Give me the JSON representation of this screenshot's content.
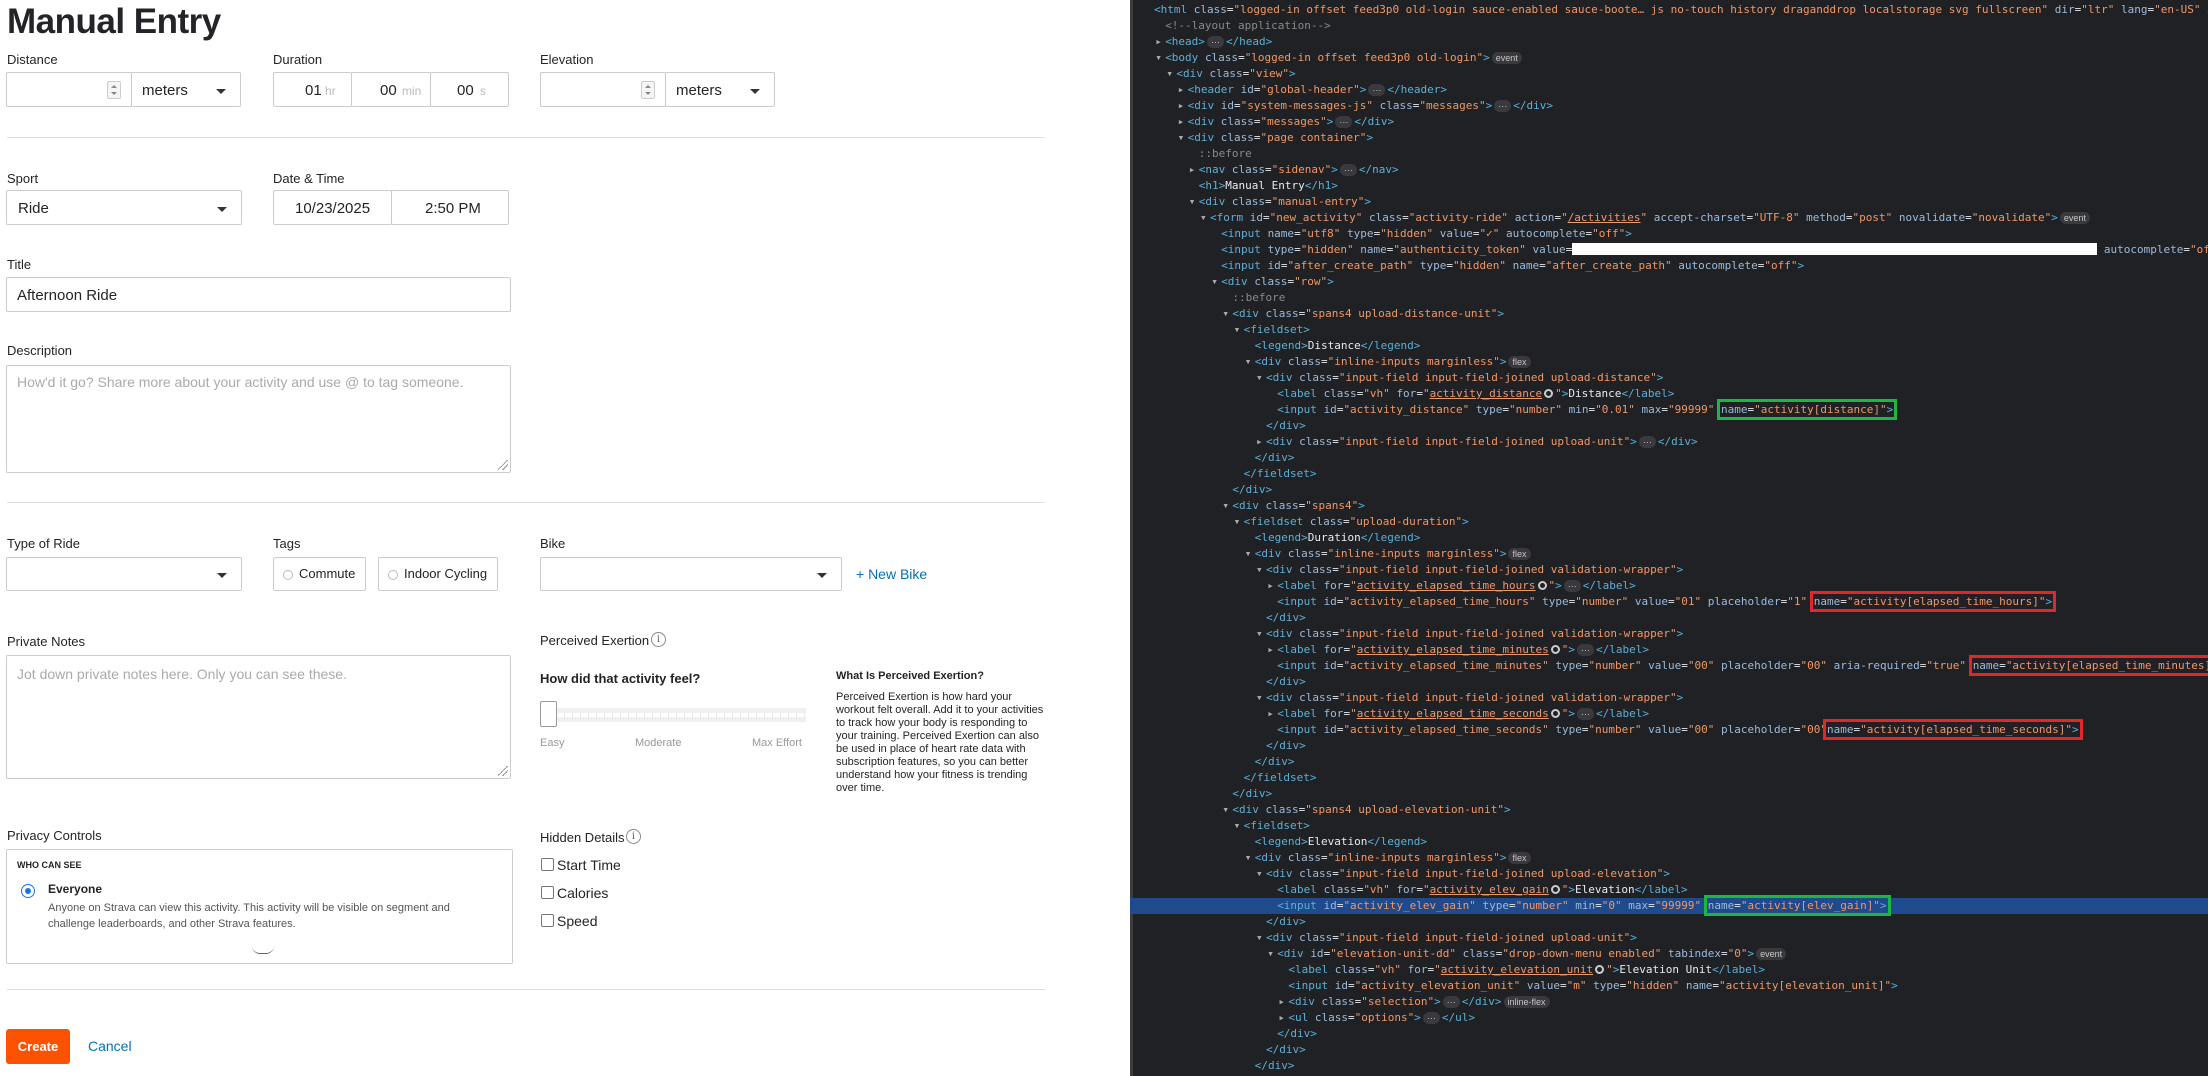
{
  "form": {
    "page_title": "Manual Entry",
    "distance": {
      "label": "Distance",
      "value": "",
      "unit": "meters"
    },
    "duration": {
      "label": "Duration",
      "hours": "01",
      "hours_unit": "hr",
      "minutes": "00",
      "minutes_unit": "min",
      "seconds": "00",
      "seconds_unit": "s"
    },
    "elevation": {
      "label": "Elevation",
      "value": "",
      "unit": "meters"
    },
    "sport": {
      "label": "Sport",
      "value": "Ride"
    },
    "datetime": {
      "label": "Date & Time",
      "date": "10/23/2025",
      "time": "2:50 PM"
    },
    "title": {
      "label": "Title",
      "value": "Afternoon Ride"
    },
    "description": {
      "label": "Description",
      "placeholder": "How'd it go? Share more about your activity and use @ to tag someone."
    },
    "type_of_ride": {
      "label": "Type of Ride",
      "value": ""
    },
    "tags": {
      "label": "Tags",
      "items": [
        "Commute",
        "Indoor Cycling"
      ]
    },
    "bike": {
      "label": "Bike",
      "value": "",
      "new_bike": "+ New Bike"
    },
    "private_notes": {
      "label": "Private Notes",
      "placeholder": "Jot down private notes here. Only you can see these."
    },
    "perceived_exertion": {
      "label": "Perceived Exertion",
      "question": "How did that activity feel?",
      "scale": [
        "Easy",
        "Moderate",
        "Max Effort"
      ],
      "level": 0,
      "help_title": "What Is Perceived Exertion?",
      "help_text": "Perceived Exertion is how hard your workout felt overall. Add it to your activities to track how your body is responding to your training. Perceived Exertion can also be used in place of heart rate data with subscription features, so you can better understand how your fitness is trending over time."
    },
    "privacy": {
      "label": "Privacy Controls",
      "who_can_see": "WHO CAN SEE",
      "option_title": "Everyone",
      "option_desc": "Anyone on Strava can view this activity. This activity will be visible on segment and challenge leaderboards, and other Strava features."
    },
    "hidden_details": {
      "label": "Hidden Details",
      "items": [
        "Start Time",
        "Calories",
        "Speed"
      ]
    },
    "create_button": "Create",
    "cancel_link": "Cancel"
  },
  "devtools": {
    "colors": {
      "tag": "#5db0d7",
      "attr_name": "#9bbbdc",
      "attr_value": "#f29766",
      "highlight_green": "#1db543",
      "highlight_red": "#e2262c"
    },
    "lines": [
      {
        "i": 0,
        "t": "",
        "h": "<span class=\"tg\">&lt;html</span> <span class=\"an\">class</span>=<span class=\"av\">\"logged-in offset feed3p0 old-login sauce-enabled sauce-boote… js no-touch history draganddrop localstorage svg fullscreen\"</span> <span class=\"an\">dir</span>=<span class=\"av\">\"ltr\"</span> <span class=\"an\">lang</span>=<span class=\"av\">\"en-US\"</span> <span class=\"an\">xmlns</span>=<span class=\"av\">\"<span class=\"lk\">http://www</span></span>"
      },
      {
        "i": 1,
        "t": "",
        "h": "<span class=\"cm\">&lt;!--layout application--&gt;</span>"
      },
      {
        "i": 1,
        "t": "▸",
        "h": "<span class=\"tg\">&lt;head&gt;</span><span class=\"pill\">···</span><span class=\"tg\">&lt;/head&gt;</span>"
      },
      {
        "i": 1,
        "t": "▾",
        "h": "<span class=\"tg\">&lt;body</span> <span class=\"an\">class</span>=<span class=\"av\">\"logged-in offset feed3p0 old-login\"</span><span class=\"tg\">&gt;</span><span class=\"pill\">event</span>"
      },
      {
        "i": 2,
        "t": "▾",
        "h": "<span class=\"tg\">&lt;div</span> <span class=\"an\">class</span>=<span class=\"av\">\"view\"</span><span class=\"tg\">&gt;</span>"
      },
      {
        "i": 3,
        "t": "▸",
        "h": "<span class=\"tg\">&lt;header</span> <span class=\"an\">id</span>=<span class=\"av\">\"global-header\"</span><span class=\"tg\">&gt;</span><span class=\"pill\">···</span><span class=\"tg\">&lt;/header&gt;</span>"
      },
      {
        "i": 3,
        "t": "▸",
        "h": "<span class=\"tg\">&lt;div</span> <span class=\"an\">id</span>=<span class=\"av\">\"system-messages-js\"</span> <span class=\"an\">class</span>=<span class=\"av\">\"messages\"</span><span class=\"tg\">&gt;</span><span class=\"pill\">···</span><span class=\"tg\">&lt;/div&gt;</span>"
      },
      {
        "i": 3,
        "t": "▸",
        "h": "<span class=\"tg\">&lt;div</span> <span class=\"an\">class</span>=<span class=\"av\">\"messages\"</span><span class=\"tg\">&gt;</span><span class=\"pill\">···</span><span class=\"tg\">&lt;/div&gt;</span>"
      },
      {
        "i": 3,
        "t": "▾",
        "h": "<span class=\"tg\">&lt;div</span> <span class=\"an\">class</span>=<span class=\"av\">\"page container\"</span><span class=\"tg\">&gt;</span>"
      },
      {
        "i": 4,
        "t": "",
        "h": "<span class=\"cm\">::before</span>"
      },
      {
        "i": 4,
        "t": "▸",
        "h": "<span class=\"tg\">&lt;nav</span> <span class=\"an\">class</span>=<span class=\"av\">\"sidenav\"</span><span class=\"tg\">&gt;</span><span class=\"pill\">···</span><span class=\"tg\">&lt;/nav&gt;</span>"
      },
      {
        "i": 4,
        "t": "",
        "h": "<span class=\"tg\">&lt;h1&gt;</span>Manual Entry<span class=\"tg\">&lt;/h1&gt;</span>"
      },
      {
        "i": 4,
        "t": "▾",
        "h": "<span class=\"tg\">&lt;div</span> <span class=\"an\">class</span>=<span class=\"av\">\"manual-entry\"</span><span class=\"tg\">&gt;</span>"
      },
      {
        "i": 5,
        "t": "▾",
        "h": "<span class=\"tg\">&lt;form</span> <span class=\"an\">id</span>=<span class=\"av\">\"new_activity\"</span> <span class=\"an\">class</span>=<span class=\"av\">\"activity-ride\"</span> <span class=\"an\">action</span>=<span class=\"av\">\"<span class=\"lk\">/activities</span>\"</span> <span class=\"an\">accept-charset</span>=<span class=\"av\">\"UTF-8\"</span> <span class=\"an\">method</span>=<span class=\"av\">\"post\"</span> <span class=\"an\">novalidate</span>=<span class=\"av\">\"novalidate\"</span><span class=\"tg\">&gt;</span><span class=\"pill\">event</span>"
      },
      {
        "i": 6,
        "t": "",
        "h": "<span class=\"tg\">&lt;input</span> <span class=\"an\">name</span>=<span class=\"av\">\"utf8\"</span> <span class=\"an\">type</span>=<span class=\"av\">\"hidden\"</span> <span class=\"an\">value</span>=<span class=\"av\">\"✓\"</span> <span class=\"an\">autocomplete</span>=<span class=\"av\">\"off\"</span><span class=\"tg\">&gt;</span>"
      },
      {
        "i": 6,
        "t": "",
        "h": "<span class=\"tg\">&lt;input</span> <span class=\"an\">type</span>=<span class=\"av\">\"hidden\"</span> <span class=\"an\">name</span>=<span class=\"av\">\"authenticity_token\"</span> <span class=\"an\">value</span>=<span class=\"redact\"></span> <span class=\"an\">autocomplete</span>=<span class=\"av\">\"off\"</span><span class=\"tg\">&gt;</span>"
      },
      {
        "i": 6,
        "t": "",
        "h": "<span class=\"tg\">&lt;input</span> <span class=\"an\">id</span>=<span class=\"av\">\"after_create_path\"</span> <span class=\"an\">type</span>=<span class=\"av\">\"hidden\"</span> <span class=\"an\">name</span>=<span class=\"av\">\"after_create_path\"</span> <span class=\"an\">autocomplete</span>=<span class=\"av\">\"off\"</span><span class=\"tg\">&gt;</span>"
      },
      {
        "i": 6,
        "t": "▾",
        "h": "<span class=\"tg\">&lt;div</span> <span class=\"an\">class</span>=<span class=\"av\">\"row\"</span><span class=\"tg\">&gt;</span>"
      },
      {
        "i": 7,
        "t": "",
        "h": "<span class=\"cm\">::before</span>"
      },
      {
        "i": 7,
        "t": "▾",
        "h": "<span class=\"tg\">&lt;div</span> <span class=\"an\">class</span>=<span class=\"av\">\"spans4 upload-distance-unit\"</span><span class=\"tg\">&gt;</span>"
      },
      {
        "i": 8,
        "t": "▾",
        "h": "<span class=\"tg\">&lt;fieldset&gt;</span>"
      },
      {
        "i": 9,
        "t": "",
        "h": "<span class=\"tg\">&lt;legend&gt;</span>Distance<span class=\"tg\">&lt;/legend&gt;</span>"
      },
      {
        "i": 9,
        "t": "▾",
        "h": "<span class=\"tg\">&lt;div</span> <span class=\"an\">class</span>=<span class=\"av\">\"inline-inputs marginless\"</span><span class=\"tg\">&gt;</span><span class=\"pill\">flex</span>"
      },
      {
        "i": 10,
        "t": "▾",
        "h": "<span class=\"tg\">&lt;div</span> <span class=\"an\">class</span>=<span class=\"av\">\"input-field input-field-joined upload-distance\"</span><span class=\"tg\">&gt;</span>"
      },
      {
        "i": 11,
        "t": "",
        "h": "<span class=\"tg\">&lt;label</span> <span class=\"an\">class</span>=<span class=\"av\">\"vh\"</span> <span class=\"an\">for</span>=<span class=\"av\">\"<span class=\"lk\">activity_distance</span></span><span class=\"gear\"></span><span class=\"av\">\"</span><span class=\"tg\">&gt;</span>Distance<span class=\"tg\">&lt;/label&gt;</span>"
      },
      {
        "i": 11,
        "t": "",
        "h": "<span class=\"tg\">&lt;input</span> <span class=\"an\">id</span>=<span class=\"av\">\"activity_distance\"</span> <span class=\"an\">type</span>=<span class=\"av\">\"number\"</span> <span class=\"an\">min</span>=<span class=\"av\">\"0.01\"</span> <span class=\"an\">max</span>=<span class=\"av\">\"99999\"</span> <span class=\"hl-green\"><span class=\"an\">name</span>=<span class=\"av\">\"activity[distance]\"</span><span class=\"tg\">&gt;</span></span>"
      },
      {
        "i": 10,
        "t": "",
        "h": "<span class=\"tg\">&lt;/div&gt;</span>"
      },
      {
        "i": 10,
        "t": "▸",
        "h": "<span class=\"tg\">&lt;div</span> <span class=\"an\">class</span>=<span class=\"av\">\"input-field input-field-joined upload-unit\"</span><span class=\"tg\">&gt;</span><span class=\"pill\">···</span><span class=\"tg\">&lt;/div&gt;</span>"
      },
      {
        "i": 9,
        "t": "",
        "h": "<span class=\"tg\">&lt;/div&gt;</span>"
      },
      {
        "i": 8,
        "t": "",
        "h": "<span class=\"tg\">&lt;/fieldset&gt;</span>"
      },
      {
        "i": 7,
        "t": "",
        "h": "<span class=\"tg\">&lt;/div&gt;</span>"
      },
      {
        "i": 7,
        "t": "▾",
        "h": "<span class=\"tg\">&lt;div</span> <span class=\"an\">class</span>=<span class=\"av\">\"spans4\"</span><span class=\"tg\">&gt;</span>"
      },
      {
        "i": 8,
        "t": "▾",
        "h": "<span class=\"tg\">&lt;fieldset</span> <span class=\"an\">class</span>=<span class=\"av\">\"upload-duration\"</span><span class=\"tg\">&gt;</span>"
      },
      {
        "i": 9,
        "t": "",
        "h": "<span class=\"tg\">&lt;legend&gt;</span>Duration<span class=\"tg\">&lt;/legend&gt;</span>"
      },
      {
        "i": 9,
        "t": "▾",
        "h": "<span class=\"tg\">&lt;div</span> <span class=\"an\">class</span>=<span class=\"av\">\"inline-inputs marginless\"</span><span class=\"tg\">&gt;</span><span class=\"pill\">flex</span>"
      },
      {
        "i": 10,
        "t": "▾",
        "h": "<span class=\"tg\">&lt;div</span> <span class=\"an\">class</span>=<span class=\"av\">\"input-field input-field-joined validation-wrapper\"</span><span class=\"tg\">&gt;</span>"
      },
      {
        "i": 11,
        "t": "▸",
        "h": "<span class=\"tg\">&lt;label</span> <span class=\"an\">for</span>=<span class=\"av\">\"<span class=\"lk\">activity_elapsed_time_hours</span></span><span class=\"gear\"></span><span class=\"av\">\"</span><span class=\"tg\">&gt;</span><span class=\"pill\">···</span><span class=\"tg\">&lt;/label&gt;</span>"
      },
      {
        "i": 11,
        "t": "",
        "h": "<span class=\"tg\">&lt;input</span> <span class=\"an\">id</span>=<span class=\"av\">\"activity_elapsed_time_hours\"</span> <span class=\"an\">type</span>=<span class=\"av\">\"number\"</span> <span class=\"an\">value</span>=<span class=\"av\">\"01\"</span> <span class=\"an\">placeholder</span>=<span class=\"av\">\"1\"</span> <span class=\"hl-red\"><span class=\"an\">name</span>=<span class=\"av\">\"activity[elapsed_time_hours]\"</span><span class=\"tg\">&gt;</span></span>"
      },
      {
        "i": 10,
        "t": "",
        "h": "<span class=\"tg\">&lt;/div&gt;</span>"
      },
      {
        "i": 10,
        "t": "▾",
        "h": "<span class=\"tg\">&lt;div</span> <span class=\"an\">class</span>=<span class=\"av\">\"input-field input-field-joined validation-wrapper\"</span><span class=\"tg\">&gt;</span>"
      },
      {
        "i": 11,
        "t": "▸",
        "h": "<span class=\"tg\">&lt;label</span> <span class=\"an\">for</span>=<span class=\"av\">\"<span class=\"lk\">activity_elapsed_time_minutes</span></span><span class=\"gear\"></span><span class=\"av\">\"</span><span class=\"tg\">&gt;</span><span class=\"pill\">···</span><span class=\"tg\">&lt;/label&gt;</span>"
      },
      {
        "i": 11,
        "t": "",
        "h": "<span class=\"tg\">&lt;input</span> <span class=\"an\">id</span>=<span class=\"av\">\"activity_elapsed_time_minutes\"</span> <span class=\"an\">type</span>=<span class=\"av\">\"number\"</span> <span class=\"an\">value</span>=<span class=\"av\">\"00\"</span> <span class=\"an\">placeholder</span>=<span class=\"av\">\"00\"</span> <span class=\"an\">aria-required</span>=<span class=\"av\">\"true\"</span> <span class=\"hl-red\"><span class=\"an\">name</span>=<span class=\"av\">\"activity[elapsed_time_minutes]\"</span><span class=\"tg\">&gt;</span></span>"
      },
      {
        "i": 10,
        "t": "",
        "h": "<span class=\"tg\">&lt;/div&gt;</span>"
      },
      {
        "i": 10,
        "t": "▾",
        "h": "<span class=\"tg\">&lt;div</span> <span class=\"an\">class</span>=<span class=\"av\">\"input-field input-field-joined validation-wrapper\"</span><span class=\"tg\">&gt;</span>"
      },
      {
        "i": 11,
        "t": "▸",
        "h": "<span class=\"tg\">&lt;label</span> <span class=\"an\">for</span>=<span class=\"av\">\"<span class=\"lk\">activity_elapsed_time_seconds</span></span><span class=\"gear\"></span><span class=\"av\">\"</span><span class=\"tg\">&gt;</span><span class=\"pill\">···</span><span class=\"tg\">&lt;/label&gt;</span>"
      },
      {
        "i": 11,
        "t": "",
        "h": "<span class=\"tg\">&lt;input</span> <span class=\"an\">id</span>=<span class=\"av\">\"activity_elapsed_time_seconds\"</span> <span class=\"an\">type</span>=<span class=\"av\">\"number\"</span> <span class=\"an\">value</span>=<span class=\"av\">\"00\"</span> <span class=\"an\">placeholder</span>=<span class=\"av\">\"00\"</span><span class=\"hl-red\"><span class=\"an\">name</span>=<span class=\"av\">\"activity[elapsed_time_seconds]\"</span><span class=\"tg\">&gt;</span></span>"
      },
      {
        "i": 10,
        "t": "",
        "h": "<span class=\"tg\">&lt;/div&gt;</span>"
      },
      {
        "i": 9,
        "t": "",
        "h": "<span class=\"tg\">&lt;/div&gt;</span>"
      },
      {
        "i": 8,
        "t": "",
        "h": "<span class=\"tg\">&lt;/fieldset&gt;</span>"
      },
      {
        "i": 7,
        "t": "",
        "h": "<span class=\"tg\">&lt;/div&gt;</span>"
      },
      {
        "i": 7,
        "t": "▾",
        "h": "<span class=\"tg\">&lt;div</span> <span class=\"an\">class</span>=<span class=\"av\">\"spans4 upload-elevation-unit\"</span><span class=\"tg\">&gt;</span>"
      },
      {
        "i": 8,
        "t": "▾",
        "h": "<span class=\"tg\">&lt;fieldset&gt;</span>"
      },
      {
        "i": 9,
        "t": "",
        "h": "<span class=\"tg\">&lt;legend&gt;</span>Elevation<span class=\"tg\">&lt;/legend&gt;</span>"
      },
      {
        "i": 9,
        "t": "▾",
        "h": "<span class=\"tg\">&lt;div</span> <span class=\"an\">class</span>=<span class=\"av\">\"inline-inputs marginless\"</span><span class=\"tg\">&gt;</span><span class=\"pill\">flex</span>"
      },
      {
        "i": 10,
        "t": "▾",
        "h": "<span class=\"tg\">&lt;div</span> <span class=\"an\">class</span>=<span class=\"av\">\"input-field input-field-joined upload-elevation\"</span><span class=\"tg\">&gt;</span>"
      },
      {
        "i": 11,
        "t": "",
        "h": "<span class=\"tg\">&lt;label</span> <span class=\"an\">class</span>=<span class=\"av\">\"vh\"</span> <span class=\"an\">for</span>=<span class=\"av\">\"<span class=\"lk\">activity_elev_gain</span></span><span class=\"gear\"></span><span class=\"av\">\"</span><span class=\"tg\">&gt;</span>Elevation<span class=\"tg\">&lt;/label&gt;</span>"
      },
      {
        "i": 11,
        "t": "",
        "sel": true,
        "h": "<span class=\"tg\">&lt;input</span> <span class=\"an\">id</span>=<span class=\"av\">\"activity_elev_gain\"</span> <span class=\"an\">type</span>=<span class=\"av\">\"number\"</span> <span class=\"an\">min</span>=<span class=\"av\">\"0\"</span> <span class=\"an\">max</span>=<span class=\"av\">\"99999\"</span> <span class=\"hl-green\"><span class=\"an\">name</span>=<span class=\"av\">\"activity[elev_gain]\"</span><span class=\"tg\">&gt;</span></span>"
      },
      {
        "i": 10,
        "t": "",
        "h": "<span class=\"tg\">&lt;/div&gt;</span>"
      },
      {
        "i": 10,
        "t": "▾",
        "h": "<span class=\"tg\">&lt;div</span> <span class=\"an\">class</span>=<span class=\"av\">\"input-field input-field-joined upload-unit\"</span><span class=\"tg\">&gt;</span>"
      },
      {
        "i": 11,
        "t": "▾",
        "h": "<span class=\"tg\">&lt;div</span> <span class=\"an\">id</span>=<span class=\"av\">\"elevation-unit-dd\"</span> <span class=\"an\">class</span>=<span class=\"av\">\"drop-down-menu enabled\"</span> <span class=\"an\">tabindex</span>=<span class=\"av\">\"0\"</span><span class=\"tg\">&gt;</span><span class=\"pill\">event</span>"
      },
      {
        "i": 12,
        "t": "",
        "h": "<span class=\"tg\">&lt;label</span> <span class=\"an\">class</span>=<span class=\"av\">\"vh\"</span> <span class=\"an\">for</span>=<span class=\"av\">\"<span class=\"lk\">activity_elevation_unit</span></span><span class=\"gear\"></span><span class=\"av\">\"</span><span class=\"tg\">&gt;</span>Elevation Unit<span class=\"tg\">&lt;/label&gt;</span>"
      },
      {
        "i": 12,
        "t": "",
        "h": "<span class=\"tg\">&lt;input</span> <span class=\"an\">id</span>=<span class=\"av\">\"activity_elevation_unit\"</span> <span class=\"an\">value</span>=<span class=\"av\">\"m\"</span> <span class=\"an\">type</span>=<span class=\"av\">\"hidden\"</span> <span class=\"an\">name</span>=<span class=\"av\">\"activity[elevation_unit]\"</span><span class=\"tg\">&gt;</span>"
      },
      {
        "i": 12,
        "t": "▸",
        "h": "<span class=\"tg\">&lt;div</span> <span class=\"an\">class</span>=<span class=\"av\">\"selection\"</span><span class=\"tg\">&gt;</span><span class=\"pill\">···</span><span class=\"tg\">&lt;/div&gt;</span><span class=\"pill\">inline-flex</span>"
      },
      {
        "i": 12,
        "t": "▸",
        "h": "<span class=\"tg\">&lt;ul</span> <span class=\"an\">class</span>=<span class=\"av\">\"options\"</span><span class=\"tg\">&gt;</span><span class=\"pill\">···</span><span class=\"tg\">&lt;/ul&gt;</span>"
      },
      {
        "i": 11,
        "t": "",
        "h": "<span class=\"tg\">&lt;/div&gt;</span>"
      },
      {
        "i": 10,
        "t": "",
        "h": "<span class=\"tg\">&lt;/div&gt;</span>"
      },
      {
        "i": 9,
        "t": "",
        "h": "<span class=\"tg\">&lt;/div&gt;</span>"
      }
    ]
  }
}
